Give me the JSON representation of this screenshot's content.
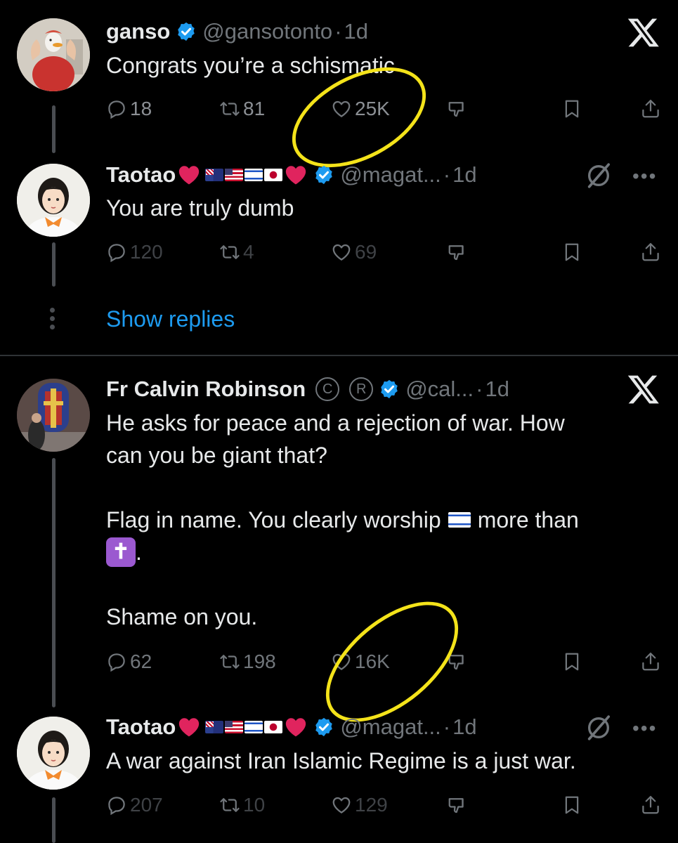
{
  "tweets": [
    {
      "name": "ganso",
      "handle": "@gansotonto",
      "time": "1d",
      "text": [
        "Congrats you’re a schismatic"
      ],
      "replies": "18",
      "reposts": "81",
      "likes": "25K"
    },
    {
      "name": "Taotao",
      "handle": "@magat...",
      "time": "1d",
      "text": [
        "You are truly dumb"
      ],
      "replies": "120",
      "reposts": "4",
      "likes": "69"
    },
    {
      "name": "Fr Calvin Robinson",
      "handle": "@cal...",
      "time": "1d",
      "text": [
        "He asks for peace and a rejection of war. How",
        "can you be giant that?",
        "Flag in name. You clearly worship",
        "more than",
        ".",
        "Shame on you."
      ],
      "replies": "62",
      "reposts": "198",
      "likes": "16K"
    },
    {
      "name": "Taotao",
      "handle": "@magat...",
      "time": "1d",
      "text": [
        "A war against Iran Islamic Regime is a just war."
      ],
      "replies": "207",
      "reposts": "10",
      "likes": "129"
    }
  ],
  "show_replies": "Show replies",
  "separator": "·",
  "icons": {
    "x_logo": "x-logo-icon",
    "verified": "verified-badge-icon",
    "reply": "reply-icon",
    "repost": "repost-icon",
    "like": "heart-icon",
    "downvote": "downvote-icon",
    "bookmark": "bookmark-icon",
    "share": "share-icon",
    "grok": "grok-icon",
    "more": "more-dots-icon"
  },
  "colors": {
    "background": "#000000",
    "verified": "#1d9bf0",
    "link": "#1d9bf0",
    "annotation_circle": "#f4e31a",
    "heart_emoji": "#e0245e",
    "cross_emoji_bg": "#9b59d0"
  }
}
